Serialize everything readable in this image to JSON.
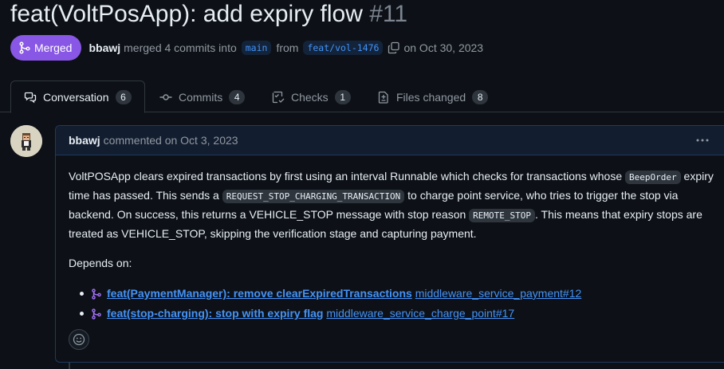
{
  "pr": {
    "title": "feat(VoltPosApp): add expiry flow",
    "number": "#11",
    "state": "Merged",
    "author": "bbawj",
    "merged_text": "merged 4 commits into",
    "base_branch": "main",
    "from_text": "from",
    "head_branch": "feat/vol-1476",
    "date_text": "on Oct 30, 2023"
  },
  "tabs": [
    {
      "label": "Conversation",
      "count": "6",
      "icon": "comment-discussion-icon"
    },
    {
      "label": "Commits",
      "count": "4",
      "icon": "git-commit-icon"
    },
    {
      "label": "Checks",
      "count": "1",
      "icon": "checklist-icon"
    },
    {
      "label": "Files changed",
      "count": "8",
      "icon": "file-diff-icon"
    }
  ],
  "comment": {
    "author": "bbawj",
    "meta": "commented on Oct 3, 2023",
    "p1_a": "VoltPOSApp clears expired transactions by first using an interval Runnable which checks for transactions whose ",
    "p1_code1": "BeepOrder",
    "p1_b": " expiry time has passed. This sends a ",
    "p1_code2": "REQUEST_STOP_CHARGING_TRANSACTION",
    "p1_c": " to charge point service, who tries to trigger the stop via backend. On success, this returns a VEHICLE_STOP message with stop reason ",
    "p1_code3": "REMOTE_STOP",
    "p1_d": ". This means that expiry stops are treated as VEHICLE_STOP, skipping the verification stage and capturing payment.",
    "depends_on": "Depends on:",
    "refs": [
      {
        "title": "feat(PaymentManager): remove clearExpiredTransactions",
        "repo": "middleware_service_payment#12"
      },
      {
        "title": "feat(stop-charging): stop with expiry flag",
        "repo": "middleware_service_charge_point#17"
      }
    ]
  },
  "colors": {
    "background": "#0d1117",
    "merged": "#8957e5",
    "link": "#4493f8",
    "muted": "#9198a1"
  }
}
